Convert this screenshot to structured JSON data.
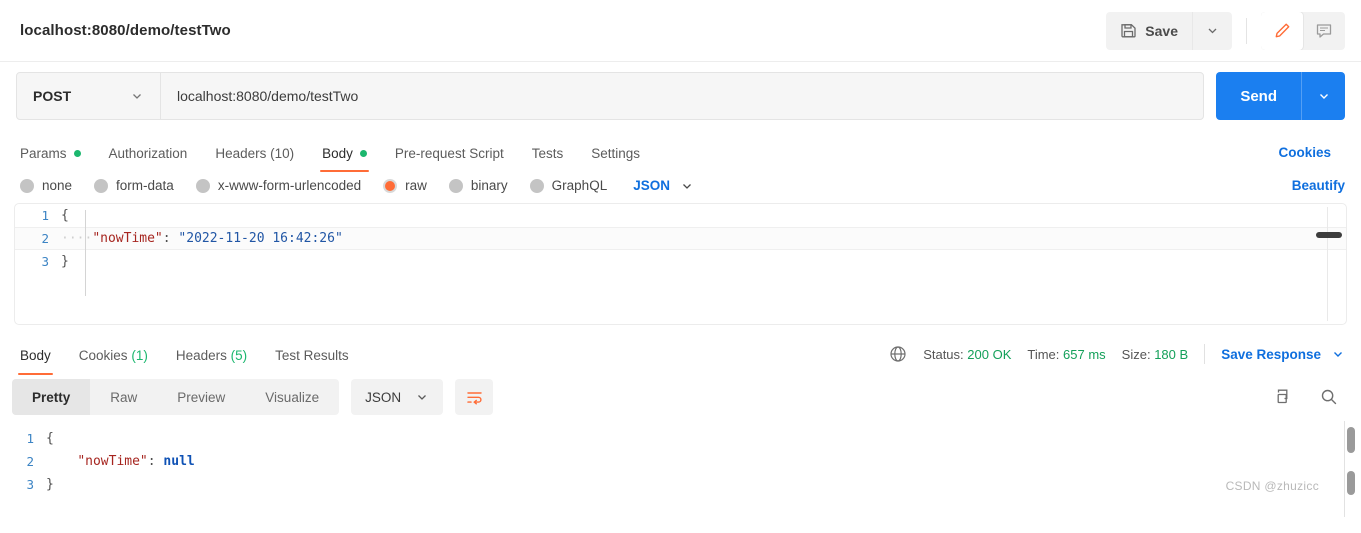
{
  "header": {
    "request_title": "localhost:8080/demo/testTwo",
    "save_label": "Save",
    "save_caret_icon": "chevron-down-icon",
    "floppy_icon": "floppy-disk-icon",
    "edit_icon": "pencil-icon",
    "comment_icon": "comment-icon"
  },
  "request": {
    "method": "POST",
    "method_caret_icon": "chevron-down-icon",
    "url_value": "localhost:8080/demo/testTwo",
    "url_placeholder": "Enter request URL",
    "send_label": "Send",
    "send_caret_icon": "chevron-down-icon"
  },
  "request_tabs": [
    {
      "label": "Params",
      "dot": true,
      "active": false
    },
    {
      "label": "Authorization",
      "dot": false,
      "active": false
    },
    {
      "label": "Headers (10)",
      "dot": false,
      "active": false
    },
    {
      "label": "Body",
      "dot": true,
      "active": true
    },
    {
      "label": "Pre-request Script",
      "dot": false,
      "active": false
    },
    {
      "label": "Tests",
      "dot": false,
      "active": false
    },
    {
      "label": "Settings",
      "dot": false,
      "active": false
    }
  ],
  "links": {
    "cookies": "Cookies",
    "beautify": "Beautify"
  },
  "body_types": [
    {
      "label": "none",
      "checked": false
    },
    {
      "label": "form-data",
      "checked": false
    },
    {
      "label": "x-www-form-urlencoded",
      "checked": false
    },
    {
      "label": "raw",
      "checked": true
    },
    {
      "label": "binary",
      "checked": false
    },
    {
      "label": "GraphQL",
      "checked": false
    }
  ],
  "body_format": {
    "value": "JSON",
    "caret_icon": "chevron-down-icon"
  },
  "request_body": {
    "lines": [
      {
        "n": "1",
        "open": "{"
      },
      {
        "n": "2",
        "indent": "····",
        "key": "\"nowTime\"",
        "colon": ": ",
        "value": "\"2022-11-20 16:42:26\""
      },
      {
        "n": "3",
        "close": "}"
      }
    ]
  },
  "response_tabs": [
    {
      "label": "Body",
      "count": "",
      "active": true
    },
    {
      "label": "Cookies",
      "count": "(1)",
      "active": false
    },
    {
      "label": "Headers",
      "count": "(5)",
      "active": false
    },
    {
      "label": "Test Results",
      "count": "",
      "active": false
    }
  ],
  "response_status": {
    "globe_icon": "globe-icon",
    "status_label": "Status:",
    "status_value": "200 OK",
    "time_label": "Time:",
    "time_value": "657 ms",
    "size_label": "Size:",
    "size_value": "180 B",
    "save_response_label": "Save Response",
    "save_response_caret_icon": "chevron-down-icon"
  },
  "response_toolbar": {
    "views": [
      {
        "label": "Pretty",
        "active": true
      },
      {
        "label": "Raw",
        "active": false
      },
      {
        "label": "Preview",
        "active": false
      },
      {
        "label": "Visualize",
        "active": false
      }
    ],
    "format": "JSON",
    "format_caret_icon": "chevron-down-icon",
    "wrap_icon": "word-wrap-icon",
    "copy_icon": "copy-icon",
    "search_icon": "search-icon"
  },
  "response_body": {
    "lines": [
      {
        "n": "1",
        "open": "{"
      },
      {
        "n": "2",
        "indent": "    ",
        "key": "\"nowTime\"",
        "colon": ": ",
        "value": "null"
      },
      {
        "n": "3",
        "close": "}"
      }
    ]
  },
  "watermark": "CSDN @zhuzicc",
  "colors": {
    "accent_orange": "#ff6c37",
    "send_blue": "#1b7ff0",
    "link_blue": "#0f6fde",
    "status_green": "#14a05a",
    "dot_green": "#1bb76e"
  }
}
